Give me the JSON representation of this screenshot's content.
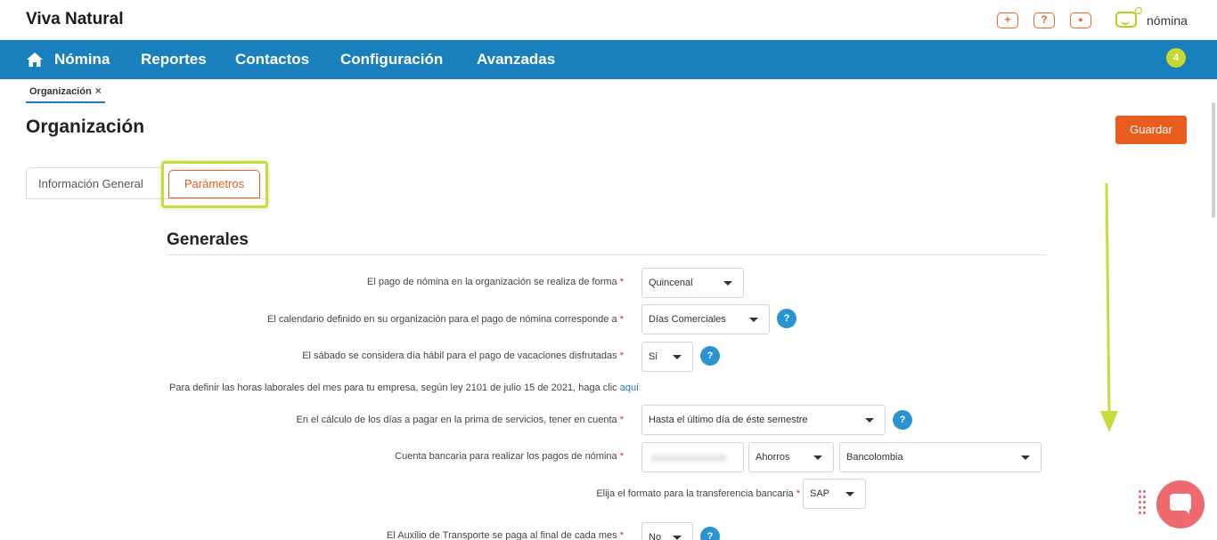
{
  "brand": "Viva Natural",
  "product_name": "nómina",
  "top_icons": [
    "plus-icon",
    "help-icon",
    "user-icon"
  ],
  "top_icon_glyphs": [
    "+",
    "?",
    "●"
  ],
  "nav": {
    "items": [
      "Nómina",
      "Reportes",
      "Contactos",
      "Configuración",
      "Avanzadas"
    ],
    "notification_count": "4"
  },
  "breadcrumb": {
    "label": "Organización",
    "close": "×"
  },
  "page_title": "Organización",
  "save_label": "Guardar",
  "tabs": [
    {
      "label": "Información General",
      "active": false
    },
    {
      "label": "Parámetros",
      "active": true
    }
  ],
  "section_title": "Generales",
  "fields": [
    {
      "label": "El pago de nómina en la organización se realiza de forma",
      "value": "Quincenal",
      "help": false
    },
    {
      "label": "El calendario definido en su organización para el pago de nómina corresponde a",
      "value": "Días Comerciales",
      "help": true
    },
    {
      "label": "El sábado se considera día hábil para el pago de vacaciones disfrutadas",
      "value": "Si",
      "help": true
    },
    {
      "label": "En el cálculo de los días a pagar en la prima de servicios, tener en cuenta",
      "value": "Hasta el último día de éste semestre",
      "help": true
    },
    {
      "label": "Cuenta bancaria para realizar los pagos de nómina",
      "account_type": "Ahorros",
      "bank": "Bancolombia",
      "help": false
    },
    {
      "label": "Elija el formato para la transferencia bancaria",
      "value": "SAP",
      "help": false
    },
    {
      "label": "El Auxilio de Transporte se paga al final de cada mes",
      "value": "No",
      "help": true
    }
  ],
  "note": {
    "text": "Para definir las horas laborales del mes para tu empresa, según ley 2101 de julio 15 de 2021, haga clic ",
    "link": "aquí"
  },
  "required_mark": "*",
  "help_glyph": "?",
  "colors": {
    "nav_blue": "#1a7fbd",
    "accent_orange": "#e85d1e",
    "highlight_green": "#c8dc3a",
    "help_blue": "#2b93d1"
  }
}
